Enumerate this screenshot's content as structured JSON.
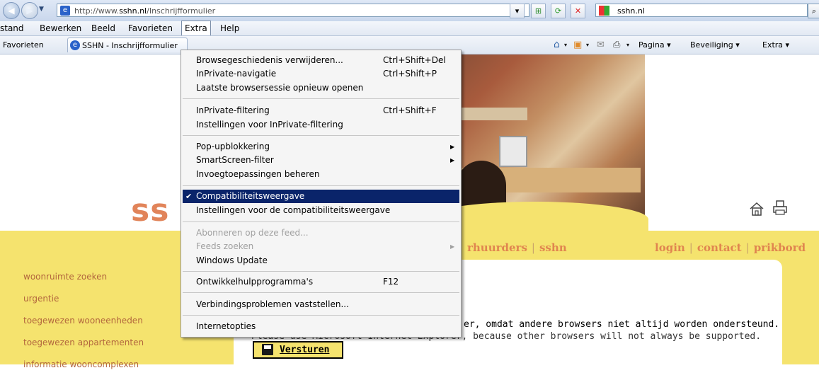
{
  "address_bar": {
    "url_prefix": "http://www.",
    "url_domain": "sshn.nl",
    "url_path": "/Inschrijfformulier",
    "search_text": "sshn.nl"
  },
  "menu_bar": {
    "items": [
      "stand",
      "Bewerken",
      "Beeld",
      "Favorieten",
      "Extra",
      "Help"
    ]
  },
  "favorites_bar": {
    "favorites_label": "Favorieten",
    "tab_title": "SSHN - Inschrijfformulier",
    "commands": [
      "Pagina ▾",
      "Beveiliging ▾",
      "Extra ▾"
    ]
  },
  "extra_menu": {
    "items": [
      {
        "label": "Browsegeschiedenis verwijderen...",
        "shortcut": "Ctrl+Shift+Del"
      },
      {
        "label": "InPrivate-navigatie",
        "shortcut": "Ctrl+Shift+P"
      },
      {
        "label": "Laatste browsersessie opnieuw openen",
        "shortcut": ""
      },
      {
        "label": "InPrivate-filtering",
        "shortcut": "Ctrl+Shift+F"
      },
      {
        "label": "Instellingen voor InPrivate-filtering",
        "shortcut": ""
      },
      {
        "label": "Pop-upblokkering",
        "shortcut": ""
      },
      {
        "label": "SmartScreen-filter",
        "shortcut": ""
      },
      {
        "label": "Invoegtoepassingen beheren",
        "shortcut": ""
      },
      {
        "label": "Compatibiliteitsweergave",
        "shortcut": ""
      },
      {
        "label": "Instellingen voor de compatibiliteitsweergave",
        "shortcut": ""
      },
      {
        "label": "Abonneren op deze feed...",
        "shortcut": ""
      },
      {
        "label": "Feeds zoeken",
        "shortcut": ""
      },
      {
        "label": "Windows Update",
        "shortcut": ""
      },
      {
        "label": "Ontwikkelhulpprogramma's",
        "shortcut": "F12"
      },
      {
        "label": "Verbindingsproblemen vaststellen...",
        "shortcut": ""
      },
      {
        "label": "Internetopties",
        "shortcut": ""
      }
    ],
    "checked_item": "Compatibiliteitsweergave"
  },
  "page": {
    "logo_text": "ss",
    "nav_left": "rhuurders",
    "nav_left_2": "sshn",
    "nav_right": [
      "login",
      "contact",
      "prikbord"
    ],
    "sidebar_links": [
      "woonruimte zoeken",
      "urgentie",
      "toegewezen wooneenheden",
      "toegewezen appartementen",
      "informatie wooncomplexen"
    ],
    "message_nl": "er, omdat andere browsers niet altijd worden ondersteund.",
    "message_en": "Please use Microsoft Internet Explorer, because other browsers will not always be supported.",
    "submit_label": "Versturen"
  },
  "colors": {
    "page_yellow": "#f5e36e",
    "brand_orange": "#e0854f",
    "menu_highlight": "#0a246a"
  }
}
